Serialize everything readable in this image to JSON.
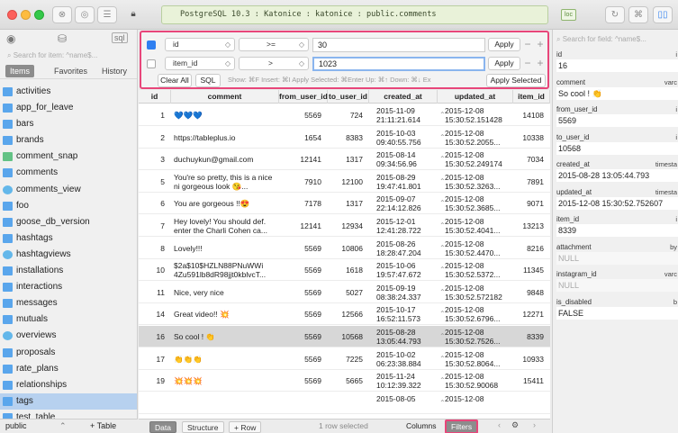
{
  "window": {
    "connection": "PostgreSQL 10.3 : Katonice : katonice : public.comments",
    "conn_badge": "loc"
  },
  "sidebar": {
    "search_placeholder": "Search for item: ^name$...",
    "tabs": [
      "Items",
      "Favorites",
      "History"
    ],
    "tables": [
      {
        "name": "activities",
        "kind": "table"
      },
      {
        "name": "app_for_leave",
        "kind": "table"
      },
      {
        "name": "bars",
        "kind": "table"
      },
      {
        "name": "brands",
        "kind": "table"
      },
      {
        "name": "comment_snap",
        "kind": "snap"
      },
      {
        "name": "comments",
        "kind": "table"
      },
      {
        "name": "comments_view",
        "kind": "view"
      },
      {
        "name": "foo",
        "kind": "table"
      },
      {
        "name": "goose_db_version",
        "kind": "table"
      },
      {
        "name": "hashtags",
        "kind": "table"
      },
      {
        "name": "hashtagviews",
        "kind": "view"
      },
      {
        "name": "installations",
        "kind": "table"
      },
      {
        "name": "interactions",
        "kind": "table"
      },
      {
        "name": "messages",
        "kind": "table"
      },
      {
        "name": "mutuals",
        "kind": "table"
      },
      {
        "name": "overviews",
        "kind": "view"
      },
      {
        "name": "proposals",
        "kind": "table"
      },
      {
        "name": "rate_plans",
        "kind": "table"
      },
      {
        "name": "relationships",
        "kind": "table"
      },
      {
        "name": "tags",
        "kind": "table"
      },
      {
        "name": "test_table",
        "kind": "table"
      }
    ],
    "selected": "tags",
    "schema": "public",
    "add_table": "+ Table"
  },
  "filters": {
    "rows": [
      {
        "enabled": true,
        "field": "id",
        "op": ">=",
        "value": "30"
      },
      {
        "enabled": false,
        "field": "item_id",
        "op": ">",
        "value": "1023"
      }
    ],
    "apply_label": "Apply",
    "clear_all": "Clear All",
    "sql": "SQL",
    "hint": "Show: ⌘F   Insert: ⌘I   Apply Selected: ⌘Enter   Up: ⌘↑   Down: ⌘↓   Ex",
    "apply_selected": "Apply Selected"
  },
  "grid": {
    "columns": [
      "id",
      "comment",
      "from_user_id",
      "to_user_id",
      "created_at",
      "updated_at",
      "item_id"
    ],
    "rows": [
      {
        "id": "1",
        "comment": "💙💙💙",
        "from_user_id": "5569",
        "to_user_id": "724",
        "created_at": "2015-11-09 21:11:21.614",
        "updated_at": "2015-12-08 15:30:52.151428",
        "item_id": "14108"
      },
      {
        "id": "2",
        "comment": "https://tableplus.io",
        "from_user_id": "1654",
        "to_user_id": "8383",
        "created_at": "2015-10-03 09:40:55.756",
        "updated_at": "2015-12-08 15:30:52.2055...",
        "item_id": "10338"
      },
      {
        "id": "3",
        "comment": "duchuykun@gmail.com",
        "from_user_id": "12141",
        "to_user_id": "1317",
        "created_at": "2015-08-14 09:34:56.96",
        "updated_at": "2015-12-08 15:30:52.249174",
        "item_id": "7034"
      },
      {
        "id": "5",
        "comment": "You're so pretty, this is a nice ni gorgeous look 😘...",
        "from_user_id": "7910",
        "to_user_id": "12100",
        "created_at": "2015-08-29 19:47:41.801",
        "updated_at": "2015-12-08 15:30:52.3263...",
        "item_id": "7891"
      },
      {
        "id": "6",
        "comment": "You are gorgeous !!😍",
        "from_user_id": "7178",
        "to_user_id": "1317",
        "created_at": "2015-09-07 22:14:12.826",
        "updated_at": "2015-12-08 15:30:52.3685...",
        "item_id": "9071"
      },
      {
        "id": "7",
        "comment": "Hey lovely! You should def. enter the Charli Cohen ca...",
        "from_user_id": "12141",
        "to_user_id": "12934",
        "created_at": "2015-12-01 12:41:28.722",
        "updated_at": "2015-12-08 15:30:52.4041...",
        "item_id": "13213"
      },
      {
        "id": "8",
        "comment": "Lovely!!!",
        "from_user_id": "5569",
        "to_user_id": "10806",
        "created_at": "2015-08-26 18:28:47.204",
        "updated_at": "2015-12-08 15:30:52.4470...",
        "item_id": "8216"
      },
      {
        "id": "10",
        "comment": "$2a$10$HZLN88PNuWWi 4Zu591lb8dR98jjt0kblvcT...",
        "from_user_id": "5569",
        "to_user_id": "1618",
        "created_at": "2015-10-06 19:57:47.672",
        "updated_at": "2015-12-08 15:30:52.5372...",
        "item_id": "11345"
      },
      {
        "id": "11",
        "comment": "Nice, very nice",
        "from_user_id": "5569",
        "to_user_id": "5027",
        "created_at": "2015-09-19 08:38:24.337",
        "updated_at": "2015-12-08 15:30:52.572182",
        "item_id": "9848"
      },
      {
        "id": "14",
        "comment": "Great video!! 💥",
        "from_user_id": "5569",
        "to_user_id": "12566",
        "created_at": "2015-10-17 16:52:11.573",
        "updated_at": "2015-12-08 15:30:52.6796...",
        "item_id": "12271"
      },
      {
        "id": "16",
        "comment": "So cool ! 👏",
        "from_user_id": "5569",
        "to_user_id": "10568",
        "created_at": "2015-08-28 13:05:44.793",
        "updated_at": "2015-12-08 15:30:52.7526...",
        "item_id": "8339",
        "highlight": true
      },
      {
        "id": "17",
        "comment": "👏👏👏",
        "from_user_id": "5569",
        "to_user_id": "7225",
        "created_at": "2015-10-02 06:23:38.884",
        "updated_at": "2015-12-08 15:30:52.8064...",
        "item_id": "10933"
      },
      {
        "id": "19",
        "comment": "💥💥💥",
        "from_user_id": "5569",
        "to_user_id": "5665",
        "created_at": "2015-11-24 10:12:39.322",
        "updated_at": "2015-12-08 15:30:52.90068",
        "item_id": "15411"
      },
      {
        "id": "",
        "comment": "",
        "from_user_id": "",
        "to_user_id": "",
        "created_at": "2015-08-05",
        "updated_at": "2015-12-08",
        "item_id": ""
      }
    ]
  },
  "bottombar": {
    "data": "Data",
    "structure": "Structure",
    "add_row": "+ Row",
    "status": "1 row selected",
    "columns": "Columns",
    "filters": "Filters"
  },
  "right_panel": {
    "search_placeholder": "Search for field: ^name$...",
    "fields": [
      {
        "label": "id",
        "type": "i",
        "value": "16"
      },
      {
        "label": "comment",
        "type": "varc",
        "value": "So cool ! 👏"
      },
      {
        "label": "from_user_id",
        "type": "i",
        "value": "5569"
      },
      {
        "label": "to_user_id",
        "type": "i",
        "value": "10568"
      },
      {
        "label": "created_at",
        "type": "timesta",
        "value": "2015-08-28 13:05:44.793"
      },
      {
        "label": "updated_at",
        "type": "timesta",
        "value": "2015-12-08 15:30:52.752607"
      },
      {
        "label": "item_id",
        "type": "i",
        "value": "8339"
      },
      {
        "label": "attachment",
        "type": "by",
        "value": "NULL",
        "null": true
      },
      {
        "label": "instagram_id",
        "type": "varc",
        "value": "NULL",
        "null": true
      },
      {
        "label": "is_disabled",
        "type": "b",
        "value": "FALSE"
      }
    ]
  },
  "colors": {
    "highlight_border": "#e8467a",
    "selected_table": "#b7d1ef",
    "checkbox_on": "#2f7ff0"
  }
}
